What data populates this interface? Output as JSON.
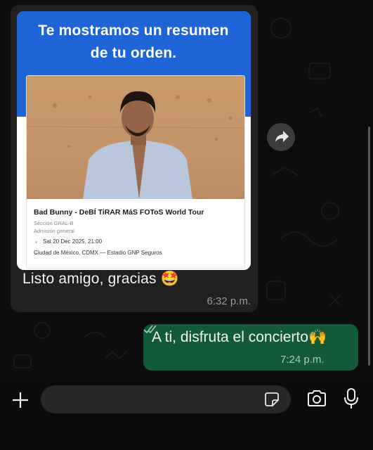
{
  "order_card": {
    "headline_line1": "Te mostramos un resumen",
    "headline_line2": "de tu orden.",
    "event_title": "Bad Bunny - DeBÍ TiRAR MáS FOToS World Tour",
    "section": "Sección GRAL-B",
    "admission": "Admisión general",
    "date": "Sat 20 Dec 2025, 21:00",
    "venue": "Ciudad de México, CDMX — Estadio GNP Seguros"
  },
  "incoming_message": {
    "text": "Listo amigo, gracias",
    "emoji": "🤩",
    "time": "6:32 p.m."
  },
  "outgoing_message": {
    "text": "A ti, disfruta el concierto",
    "emoji": "🙌",
    "time": "7:24 p.m.",
    "status": "read"
  },
  "composer": {
    "value": "",
    "placeholder": ""
  },
  "icons": {
    "forward": "forward-icon",
    "attach": "plus-icon",
    "sticker": "sticker-icon",
    "camera": "camera-icon",
    "mic": "microphone-icon"
  },
  "colors": {
    "incoming_bubble": "#202020",
    "outgoing_bubble": "#135a38",
    "card_header": "#1f64d6"
  }
}
